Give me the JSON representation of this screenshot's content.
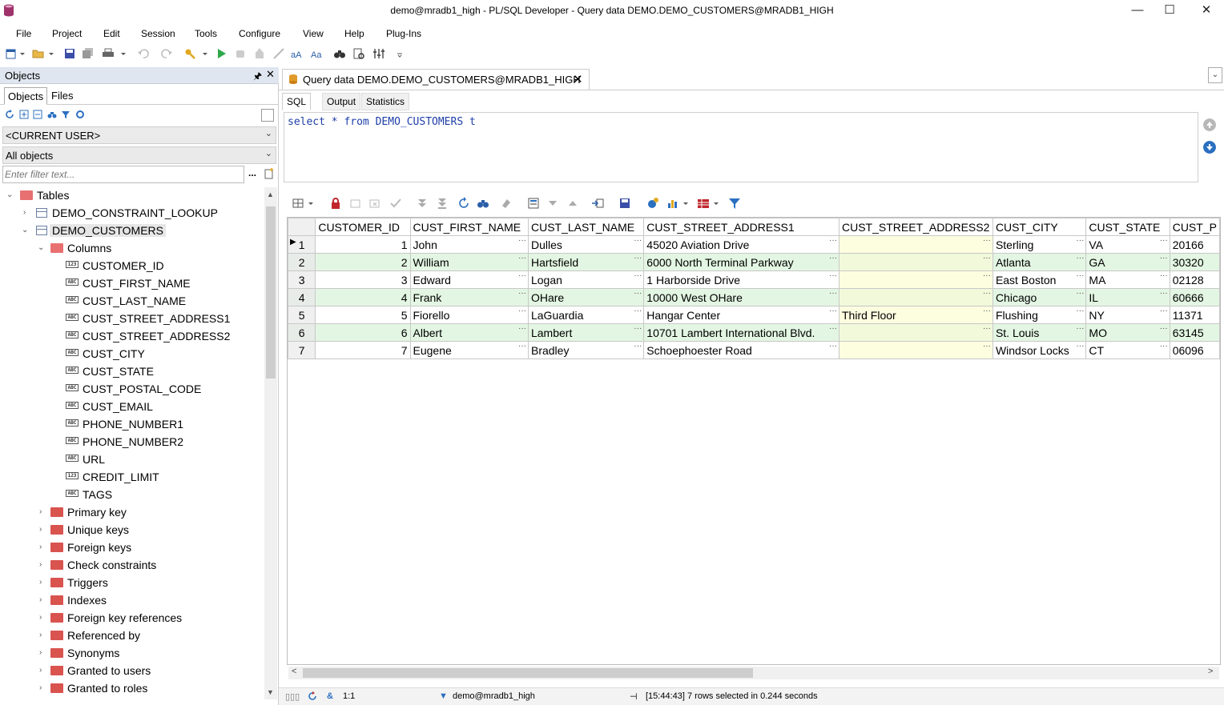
{
  "window": {
    "title": "demo@mradb1_high - PL/SQL Developer - Query data DEMO.DEMO_CUSTOMERS@MRADB1_HIGH",
    "minimize": "—",
    "maximize": "☐",
    "close": "✕"
  },
  "menu": [
    "File",
    "Project",
    "Edit",
    "Session",
    "Tools",
    "Configure",
    "View",
    "Help",
    "Plug-Ins"
  ],
  "objects_panel": {
    "title": "Objects",
    "tabs": [
      "Objects",
      "Files"
    ],
    "user_combo": "<CURRENT USER>",
    "type_combo": "All objects",
    "filter_placeholder": "Enter filter text...",
    "filter_dots": "...",
    "tree": {
      "tables_label": "Tables",
      "tables": [
        "DEMO_CONSTRAINT_LOOKUP",
        "DEMO_CUSTOMERS"
      ],
      "columns_label": "Columns",
      "columns": [
        {
          "name": "CUSTOMER_ID",
          "type": "123"
        },
        {
          "name": "CUST_FIRST_NAME",
          "type": "ABC"
        },
        {
          "name": "CUST_LAST_NAME",
          "type": "ABC"
        },
        {
          "name": "CUST_STREET_ADDRESS1",
          "type": "ABC"
        },
        {
          "name": "CUST_STREET_ADDRESS2",
          "type": "ABC"
        },
        {
          "name": "CUST_CITY",
          "type": "ABC"
        },
        {
          "name": "CUST_STATE",
          "type": "ABC"
        },
        {
          "name": "CUST_POSTAL_CODE",
          "type": "ABC"
        },
        {
          "name": "CUST_EMAIL",
          "type": "ABC"
        },
        {
          "name": "PHONE_NUMBER1",
          "type": "ABC"
        },
        {
          "name": "PHONE_NUMBER2",
          "type": "ABC"
        },
        {
          "name": "URL",
          "type": "ABC"
        },
        {
          "name": "CREDIT_LIMIT",
          "type": "123"
        },
        {
          "name": "TAGS",
          "type": "ABC"
        }
      ],
      "folders": [
        "Primary key",
        "Unique keys",
        "Foreign keys",
        "Check constraints",
        "Triggers",
        "Indexes",
        "Foreign key references",
        "Referenced by",
        "Synonyms",
        "Granted to users",
        "Granted to roles"
      ]
    }
  },
  "document_tab": {
    "title": "Query data DEMO.DEMO_CUSTOMERS@MRADB1_HIGH",
    "close": "✕"
  },
  "sub_tabs": [
    "SQL",
    "Output",
    "Statistics"
  ],
  "sql": {
    "kw1": "select",
    "star": "*",
    "kw2": "from",
    "table": "DEMO_CUSTOMERS",
    "alias": "t"
  },
  "grid": {
    "columns": [
      "CUSTOMER_ID",
      "CUST_FIRST_NAME",
      "CUST_LAST_NAME",
      "CUST_STREET_ADDRESS1",
      "CUST_STREET_ADDRESS2",
      "CUST_CITY",
      "CUST_STATE",
      "CUST_P"
    ],
    "rows": [
      {
        "rn": "1",
        "id": "1",
        "first": "John",
        "last": "Dulles",
        "addr1": "45020 Aviation Drive",
        "addr2": "",
        "city": "Sterling",
        "state": "VA",
        "postal": "20166"
      },
      {
        "rn": "2",
        "id": "2",
        "first": "William",
        "last": "Hartsfield",
        "addr1": "6000 North Terminal Parkway",
        "addr2": "",
        "city": "Atlanta",
        "state": "GA",
        "postal": "30320"
      },
      {
        "rn": "3",
        "id": "3",
        "first": "Edward",
        "last": "Logan",
        "addr1": "1 Harborside Drive",
        "addr2": "",
        "city": "East Boston",
        "state": "MA",
        "postal": "02128"
      },
      {
        "rn": "4",
        "id": "4",
        "first": "Frank",
        "last": "OHare",
        "addr1": "10000 West OHare",
        "addr2": "",
        "city": "Chicago",
        "state": "IL",
        "postal": "60666"
      },
      {
        "rn": "5",
        "id": "5",
        "first": "Fiorello",
        "last": "LaGuardia",
        "addr1": "Hangar Center",
        "addr2": "Third Floor",
        "city": "Flushing",
        "state": "NY",
        "postal": "11371"
      },
      {
        "rn": "6",
        "id": "6",
        "first": "Albert",
        "last": "Lambert",
        "addr1": "10701 Lambert International Blvd.",
        "addr2": "",
        "city": "St. Louis",
        "state": "MO",
        "postal": "63145"
      },
      {
        "rn": "7",
        "id": "7",
        "first": "Eugene",
        "last": "Bradley",
        "addr1": "Schoephoester Road",
        "addr2": "",
        "city": "Windsor Locks",
        "state": "CT",
        "postal": "06096"
      }
    ],
    "cell_button": "···",
    "current_row_marker": "▶"
  },
  "status": {
    "cursor": "1:1",
    "connection": "demo@mradb1_high",
    "message": "[15:44:43]  7 rows selected in 0.244 seconds"
  },
  "colors": {
    "even_row": "#e3f6e3",
    "addr2_cell": "#fdfde0",
    "folder": "#d9534f",
    "panel_header": "#dfe6ef"
  }
}
